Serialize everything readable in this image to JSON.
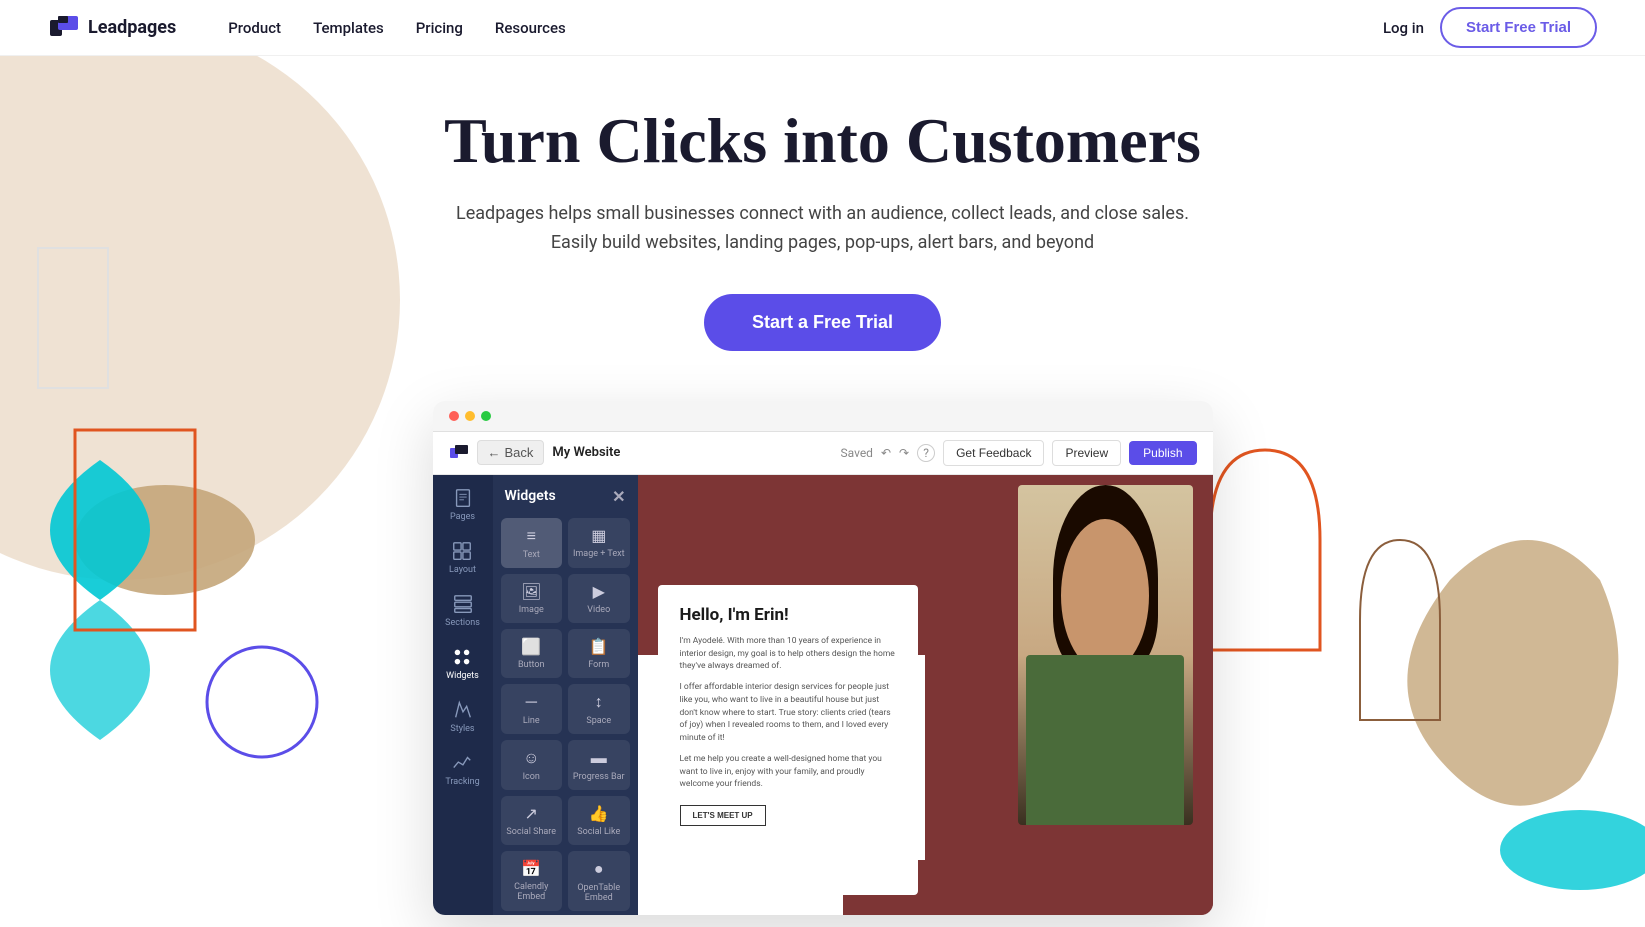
{
  "nav": {
    "logo_text": "Leadpages",
    "links": [
      "Product",
      "Templates",
      "Pricing",
      "Resources"
    ],
    "login_label": "Log in",
    "cta_label": "Start Free Trial"
  },
  "hero": {
    "title": "Turn Clicks into Customers",
    "subtitle_line1": "Leadpages helps small businesses connect with an audience, collect leads, and close sales.",
    "subtitle_line2": "Easily build websites, landing pages, pop-ups, alert bars, and beyond",
    "cta_label": "Start a Free Trial"
  },
  "browser": {
    "back_label": "Back",
    "site_name": "My Website",
    "saved_label": "Saved",
    "feedback_label": "Get Feedback",
    "preview_label": "Preview",
    "publish_label": "Publish"
  },
  "sidebar": {
    "items": [
      {
        "label": "Pages",
        "icon": "pages"
      },
      {
        "label": "Layout",
        "icon": "layout"
      },
      {
        "label": "Sections",
        "icon": "sections"
      },
      {
        "label": "Widgets",
        "icon": "widgets",
        "active": true
      },
      {
        "label": "Styles",
        "icon": "styles"
      },
      {
        "label": "Tracking",
        "icon": "tracking"
      }
    ]
  },
  "widgets": {
    "header": "Widgets",
    "items": [
      {
        "label": "Text",
        "icon": "≡",
        "active": true
      },
      {
        "label": "Image + Text",
        "icon": "▦"
      },
      {
        "label": "Image",
        "icon": "🖼"
      },
      {
        "label": "Video",
        "icon": "▶"
      },
      {
        "label": "Button",
        "icon": "⬜"
      },
      {
        "label": "Form",
        "icon": "📋"
      },
      {
        "label": "Line",
        "icon": "─"
      },
      {
        "label": "Space",
        "icon": "↕"
      },
      {
        "label": "Icon",
        "icon": "☺"
      },
      {
        "label": "Progress Bar",
        "icon": "▬"
      },
      {
        "label": "Social Share",
        "icon": "↗"
      },
      {
        "label": "Social Like",
        "icon": "👍"
      },
      {
        "label": "Calendly Embed",
        "icon": "📅"
      },
      {
        "label": "OpenTable Embed",
        "icon": "●"
      }
    ]
  },
  "page_content": {
    "hello_title": "Hello, I'm Erin!",
    "para1": "I'm Ayodelé. With more than 10 years of experience in interior design, my goal is to help others design the home they've always dreamed of.",
    "para2": "I offer affordable interior design services for people just like you, who want to live in a beautiful house but just don't know where to start. True story: clients cried (tears of joy) when I revealed rooms to them, and I loved every minute of it!",
    "para3": "Let me help you create a well-designed home that you want to live in, enjoy with your family, and proudly welcome your friends.",
    "cta_label": "LET'S MEET UP"
  },
  "colors": {
    "accent_purple": "#5b4de8",
    "accent_blue": "#00c8d4",
    "nav_border": "#e8e8e8",
    "dark_navy": "#1e2a4a",
    "dark_blue": "#263354",
    "page_red": "#7d2b2b"
  },
  "decorations": {
    "circle_beige_radius": 300,
    "ellipse_tan": true,
    "cyan_hourglass": true,
    "orange_circle": true,
    "white_rect": true,
    "right_arch": true,
    "right_tan": true
  }
}
